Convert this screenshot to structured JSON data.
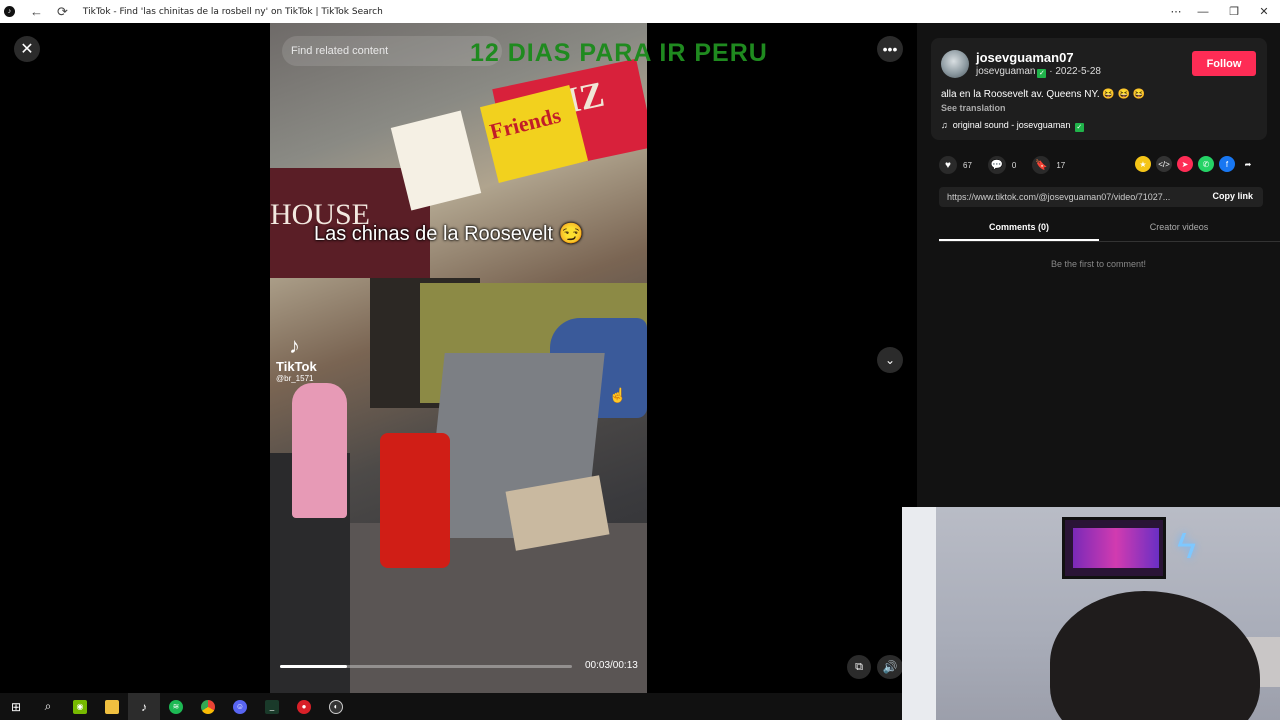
{
  "window": {
    "title": "TikTok - Find 'las chinitas de la rosbell ny' on TikTok | TikTok Search",
    "back_glyph": "←",
    "reload_glyph": "⟳",
    "more_glyph": "⋯",
    "min_glyph": "—",
    "restore_glyph": "❐",
    "close_glyph": "✕"
  },
  "video": {
    "find_related_placeholder": "Find related content",
    "overlay_title": "12 DIAS PARA IR PERU",
    "caption": "Las chinas de la Roosevelt 😏",
    "watermark_brand": "TikTok",
    "watermark_user": "@br_1571",
    "time": "00:03/00:13",
    "progress": 0.23,
    "sign_friends": "Friends",
    "sign_pizza": "PIZ",
    "sign_house": "HOUSE",
    "close_glyph": "✕",
    "more_glyph": "•••",
    "down_glyph": "⌄",
    "mini_glyph": "⧉",
    "volume_glyph": "🔊"
  },
  "author": {
    "username": "josevguaman07",
    "handle": "josevguaman",
    "verified_glyph": "✓",
    "date": "2022-5-28",
    "follow_label": "Follow",
    "description": "alla en la Roosevelt av. Queens NY. 😆 😆 😆",
    "see_translation": "See translation",
    "sound": "original sound - josevguaman",
    "note_glyph": "♫"
  },
  "stats": {
    "likes": "67",
    "comments": "0",
    "saves": "17",
    "like_glyph": "♥",
    "comment_glyph": "💬",
    "save_glyph": "🔖"
  },
  "share": {
    "link": "https://www.tiktok.com/@josevguaman07/video/71027...",
    "copy_label": "Copy link",
    "icons": [
      "coin-icon",
      "embed-icon",
      "send-icon",
      "whatsapp-icon",
      "facebook-icon",
      "share-arrow-icon"
    ],
    "colors": {
      "coin": "#f5c518",
      "embed": "#333333",
      "send": "#fe2c55",
      "whatsapp": "#25d366",
      "facebook": "#1877f2",
      "follow": "#fe2c55",
      "overlay_title": "#1f8a1f"
    }
  },
  "tabs": {
    "comments": "Comments (0)",
    "creator_videos": "Creator videos"
  },
  "comments_empty": "Be the first to comment!",
  "taskbar": {
    "items": [
      "windows-start",
      "search",
      "nvidia",
      "file-explorer",
      "tiktok",
      "spotify",
      "chrome",
      "discord",
      "terminal",
      "obs",
      "other-app"
    ]
  }
}
